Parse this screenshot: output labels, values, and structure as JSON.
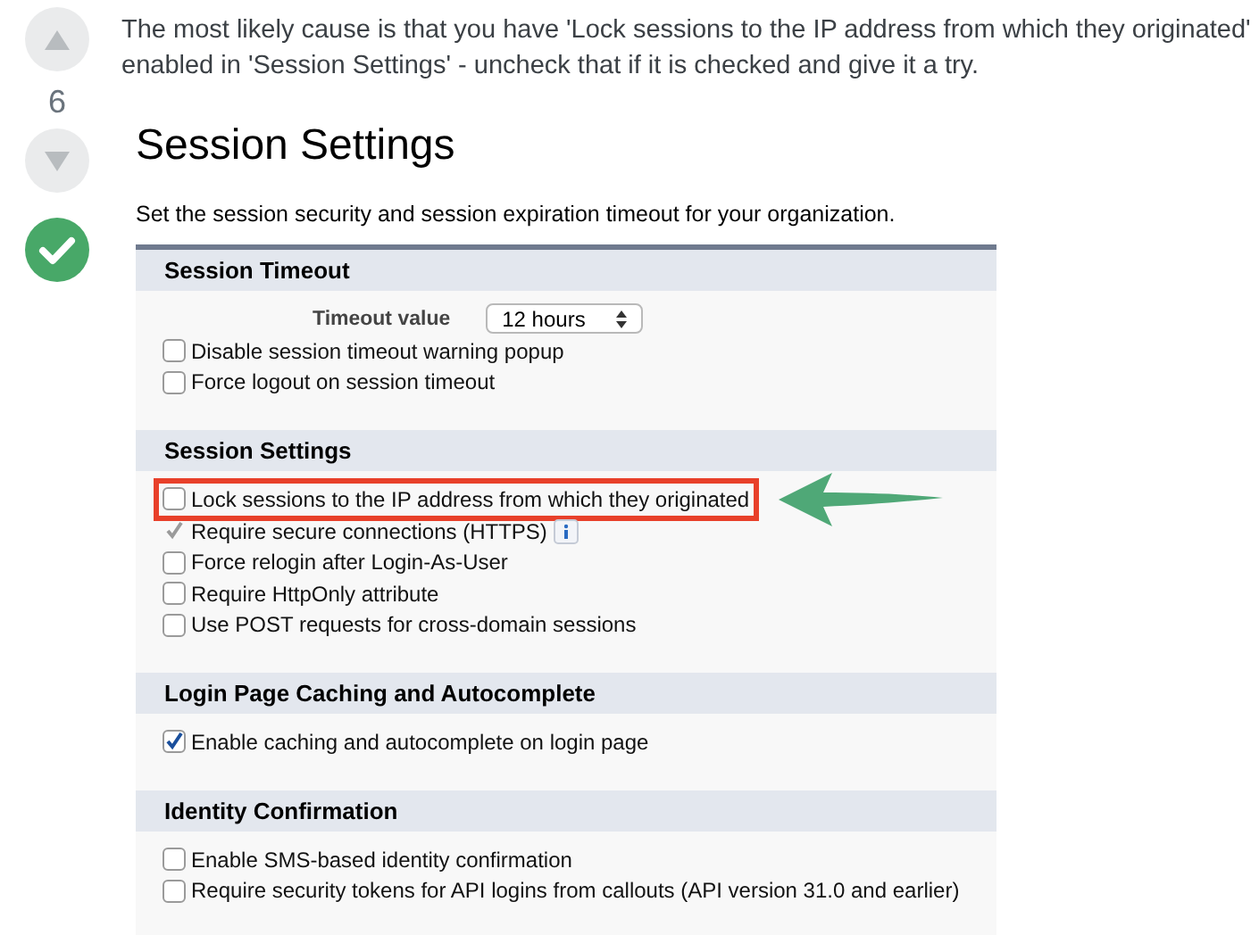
{
  "votes": {
    "count": "6",
    "accepted": true
  },
  "answer": {
    "text": "The most likely cause is that you have 'Lock sessions to the IP address from which they originated' enabled in 'Session Settings' - uncheck that if it is checked and give it a try."
  },
  "screenshot": {
    "title": "Session Settings",
    "description": "Set the session security and session expiration timeout for your organization.",
    "sections": [
      {
        "heading": "Session Timeout",
        "field": {
          "label": "Timeout value",
          "value": "12 hours"
        },
        "items": [
          {
            "label": "Disable session timeout warning popup",
            "checked": false,
            "disabled": false,
            "highlighted": false,
            "info": false
          },
          {
            "label": "Force logout on session timeout",
            "checked": false,
            "disabled": false,
            "highlighted": false,
            "info": false
          }
        ]
      },
      {
        "heading": "Session Settings",
        "items": [
          {
            "label": "Lock sessions to the IP address from which they originated",
            "checked": false,
            "disabled": false,
            "highlighted": true,
            "info": false
          },
          {
            "label": "Require secure connections (HTTPS)",
            "checked": true,
            "disabled": true,
            "highlighted": false,
            "info": true
          },
          {
            "label": "Force relogin after Login-As-User",
            "checked": false,
            "disabled": false,
            "highlighted": false,
            "info": false
          },
          {
            "label": "Require HttpOnly attribute",
            "checked": false,
            "disabled": false,
            "highlighted": false,
            "info": false
          },
          {
            "label": "Use POST requests for cross-domain sessions",
            "checked": false,
            "disabled": false,
            "highlighted": false,
            "info": false
          }
        ]
      },
      {
        "heading": "Login Page Caching and Autocomplete",
        "items": [
          {
            "label": "Enable caching and autocomplete on login page",
            "checked": true,
            "disabled": false,
            "highlighted": false,
            "info": false
          }
        ]
      },
      {
        "heading": "Identity Confirmation",
        "items": [
          {
            "label": "Enable SMS-based identity confirmation",
            "checked": false,
            "disabled": false,
            "highlighted": false,
            "info": false
          },
          {
            "label": "Require security tokens for API logins from callouts (API version 31.0 and earlier)",
            "checked": false,
            "disabled": false,
            "highlighted": false,
            "info": false
          }
        ]
      }
    ]
  }
}
